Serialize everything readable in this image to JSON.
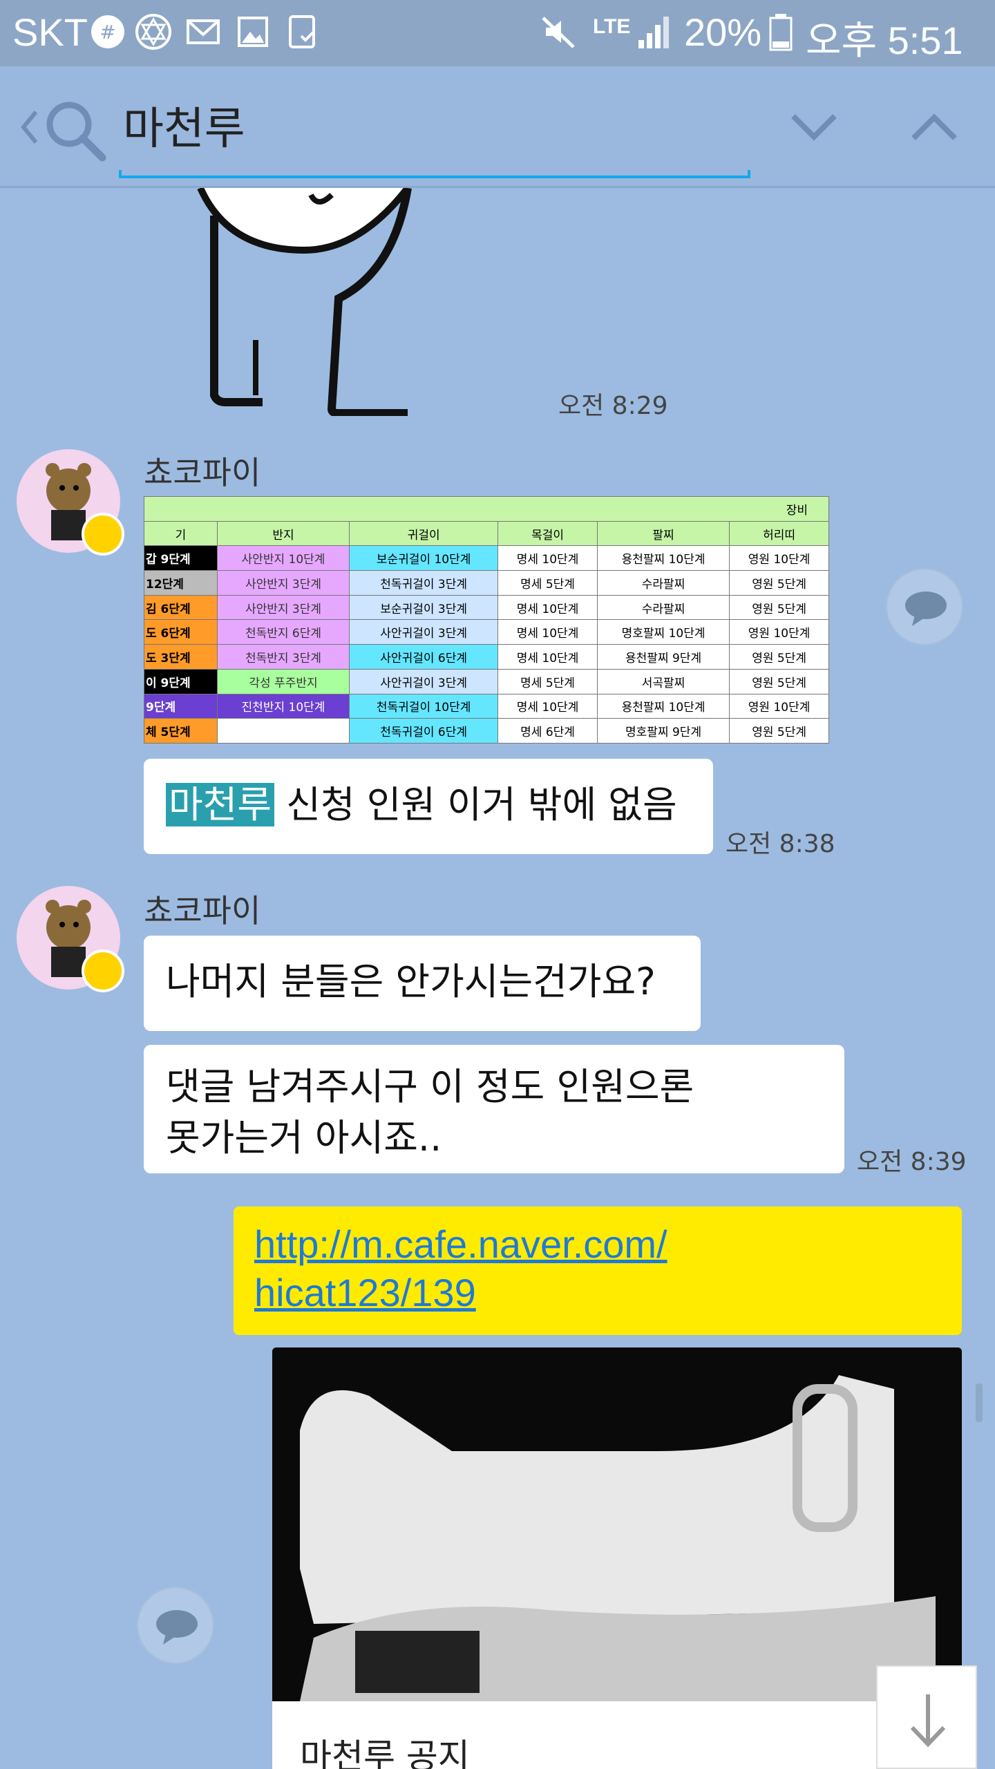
{
  "status_bar": {
    "carrier": "SKT",
    "battery": "20%",
    "time": "오후 5:51",
    "network": "LTE"
  },
  "search": {
    "query": "마천루"
  },
  "messages": [
    {
      "type": "sticker",
      "time": "오전 8:29"
    },
    {
      "sender": "쵸코파이",
      "type": "image"
    },
    {
      "text_highlight": "마천루",
      "text_rest": " 신청 인원 이거 밖에 없음",
      "time": "오전 8:38"
    },
    {
      "sender": "쵸코파이",
      "text": "나머지 분들은 안가시는건가요?"
    },
    {
      "line1": "댓글 남겨주시구  이 정도 인원으론",
      "line2": "못가는거 아시죠..",
      "time": "오전 8:39"
    },
    {
      "link_line1": "http://m.cafe.naver.com/",
      "link_line2": "hicat123/139",
      "preview_title": "마천루 공지"
    }
  ],
  "table": {
    "title": "장비",
    "headers": [
      "기",
      "반지",
      "귀걸이",
      "목걸이",
      "팔찌",
      "허리띠"
    ],
    "rows": [
      [
        "갑 9단계",
        "사안반지 10단계",
        "보순귀걸이 10단계",
        "명세 10단계",
        "용천팔찌 10단계",
        "영원 10단계"
      ],
      [
        "12단계",
        "사안반지 3단계",
        "천독귀걸이 3단계",
        "명세 5단계",
        "수라팔찌",
        "영원 5단계"
      ],
      [
        "김 6단계",
        "사안반지 3단계",
        "보순귀걸이 3단계",
        "명세 10단계",
        "수라팔찌",
        "영원 5단계"
      ],
      [
        "도 6단계",
        "천독반지 6단계",
        "사안귀걸이 3단계",
        "명세 10단계",
        "명호팔찌 10단계",
        "영원 10단계"
      ],
      [
        "도 3단계",
        "천독반지 3단계",
        "사안귀걸이 6단계",
        "명세 10단계",
        "용천팔찌 9단계",
        "영원 5단계"
      ],
      [
        "이 9단계",
        "각성 푸주반지",
        "사안귀걸이 3단계",
        "명세 5단계",
        "서곡팔찌",
        "영원 5단계"
      ],
      [
        "9단계",
        "진천반지 10단계",
        "천독귀걸이 10단계",
        "명세 10단계",
        "용천팔찌 10단계",
        "영원 10단계"
      ],
      [
        "체 5단계",
        "",
        "천독귀걸이 6단계",
        "명세 6단계",
        "명호팔찌 9단계",
        "영원 5단계"
      ]
    ]
  }
}
